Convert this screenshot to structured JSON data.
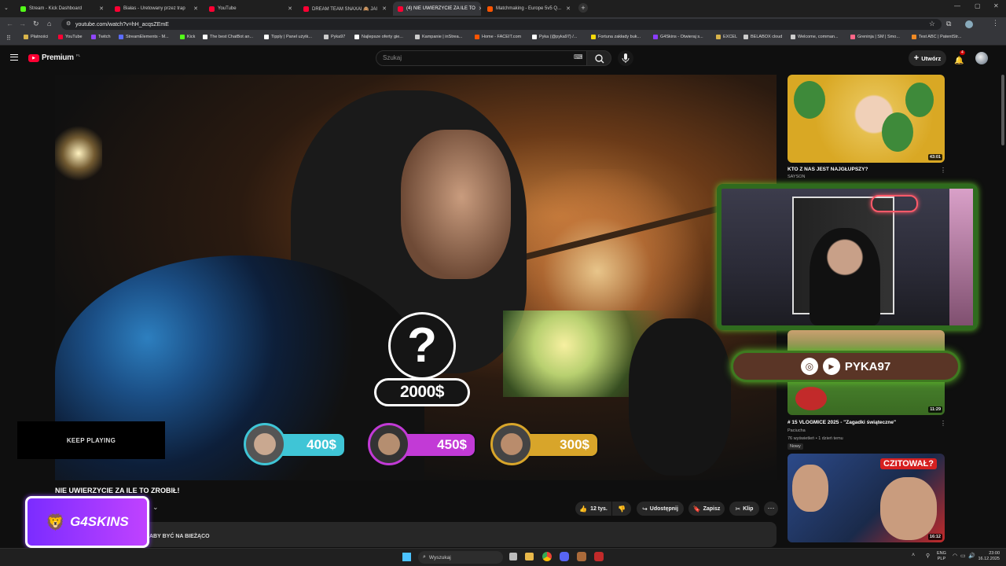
{
  "browser": {
    "tabs": [
      {
        "title": "Stream - Kick Dashboard",
        "color": "#53fc18",
        "active": false
      },
      {
        "title": "Białas - Uretowany przez trap",
        "color": "#ff0033",
        "active": false
      },
      {
        "title": "YouTube",
        "color": "#ff0033",
        "active": false
      },
      {
        "title": "DREAM TEAM SNAXAI 🙈 JAI",
        "color": "#ff0033",
        "active": false
      },
      {
        "title": "(4) NIE UWIERZYCIE ZA ILE TO",
        "color": "#ff0033",
        "active": true
      },
      {
        "title": "Matchmaking - Europe 5v5 Q...",
        "color": "#ff5500",
        "active": false
      }
    ],
    "url": "youtube.com/watch?v=hH_acqsZEmE",
    "bookmarks": [
      {
        "label": "Płatności",
        "color": "#d9b44a"
      },
      {
        "label": "YouTube",
        "color": "#ff0033"
      },
      {
        "label": "Twitch",
        "color": "#9146ff"
      },
      {
        "label": "StreamElements - M...",
        "color": "#5b6cff"
      },
      {
        "label": "Kick",
        "color": "#53fc18"
      },
      {
        "label": "The best ChatBot an...",
        "color": "#ffffff"
      },
      {
        "label": "Tipply | Panel użytk...",
        "color": "#ffffff"
      },
      {
        "label": "Pyka97",
        "color": "#cccccc"
      },
      {
        "label": "Najlepsze oferty gie...",
        "color": "#ffffff"
      },
      {
        "label": "Kampanie | inStrea...",
        "color": "#cccccc"
      },
      {
        "label": "Home - FACEIT.com",
        "color": "#ff5500"
      },
      {
        "label": "Pyka (@pyka97) /...",
        "color": "#ffffff"
      },
      {
        "label": "Fortuna zakłady buk...",
        "color": "#f5d90a"
      },
      {
        "label": "G4Skins - Otwieraj s...",
        "color": "#8a3cff"
      },
      {
        "label": "EXCEL",
        "color": "#d9b44a"
      },
      {
        "label": "BELABOX cloud",
        "color": "#cccccc"
      },
      {
        "label": "Welcome, comman...",
        "color": "#cccccc"
      },
      {
        "label": "Greninja | SM | Smo...",
        "color": "#ff6688"
      },
      {
        "label": "Test ABC | PatentStr...",
        "color": "#f08a24"
      }
    ]
  },
  "youtube": {
    "logo_text": "Premium",
    "logo_sup": "PL",
    "search_placeholder": "Szukaj",
    "create_label": "Utwórz",
    "notif_count": "4",
    "video_title": "NIE UWIERZYCIE ZA ILE TO ZROBIŁ!",
    "likes": "12 tys.",
    "share_label": "Udostępnij",
    "save_label": "Zapisz",
    "clip_label": "Klip",
    "desc_snippet": "ABY BYĆ NA BIEŻĄCO"
  },
  "overlay": {
    "keep_playing": "KEEP PLAYING",
    "question": "?",
    "big_price": "2000$",
    "prices": [
      {
        "value": "400$",
        "color": "#3fc5d6"
      },
      {
        "value": "450$",
        "color": "#c23ad6"
      },
      {
        "value": "300$",
        "color": "#d8a52a"
      }
    ],
    "social_handle": "PYKA97",
    "sponsor": "G4SKINS"
  },
  "sidebar": {
    "videos": [
      {
        "title": "KTO Z NAS JEST NAJGŁUPSZY?",
        "channel": "SAYSON",
        "duration": "43:01",
        "meta": ""
      },
      {
        "title": "# 15 VLOGMICE 2025 - \"Zagadki świąteczne\"",
        "channel": "Paciucha",
        "duration": "11:29",
        "meta": "76 wyświetleń • 1 dzień temu",
        "badge": "Nowy"
      },
      {
        "title": "",
        "channel": "",
        "duration": "16:12",
        "meta": "",
        "thumb_text": "CZITOWAŁ?"
      }
    ]
  },
  "taskbar": {
    "search_label": "Wyszukaj",
    "lang": "ENG",
    "lang2": "PLP",
    "time": "23:00",
    "date": "16.12.2025"
  }
}
